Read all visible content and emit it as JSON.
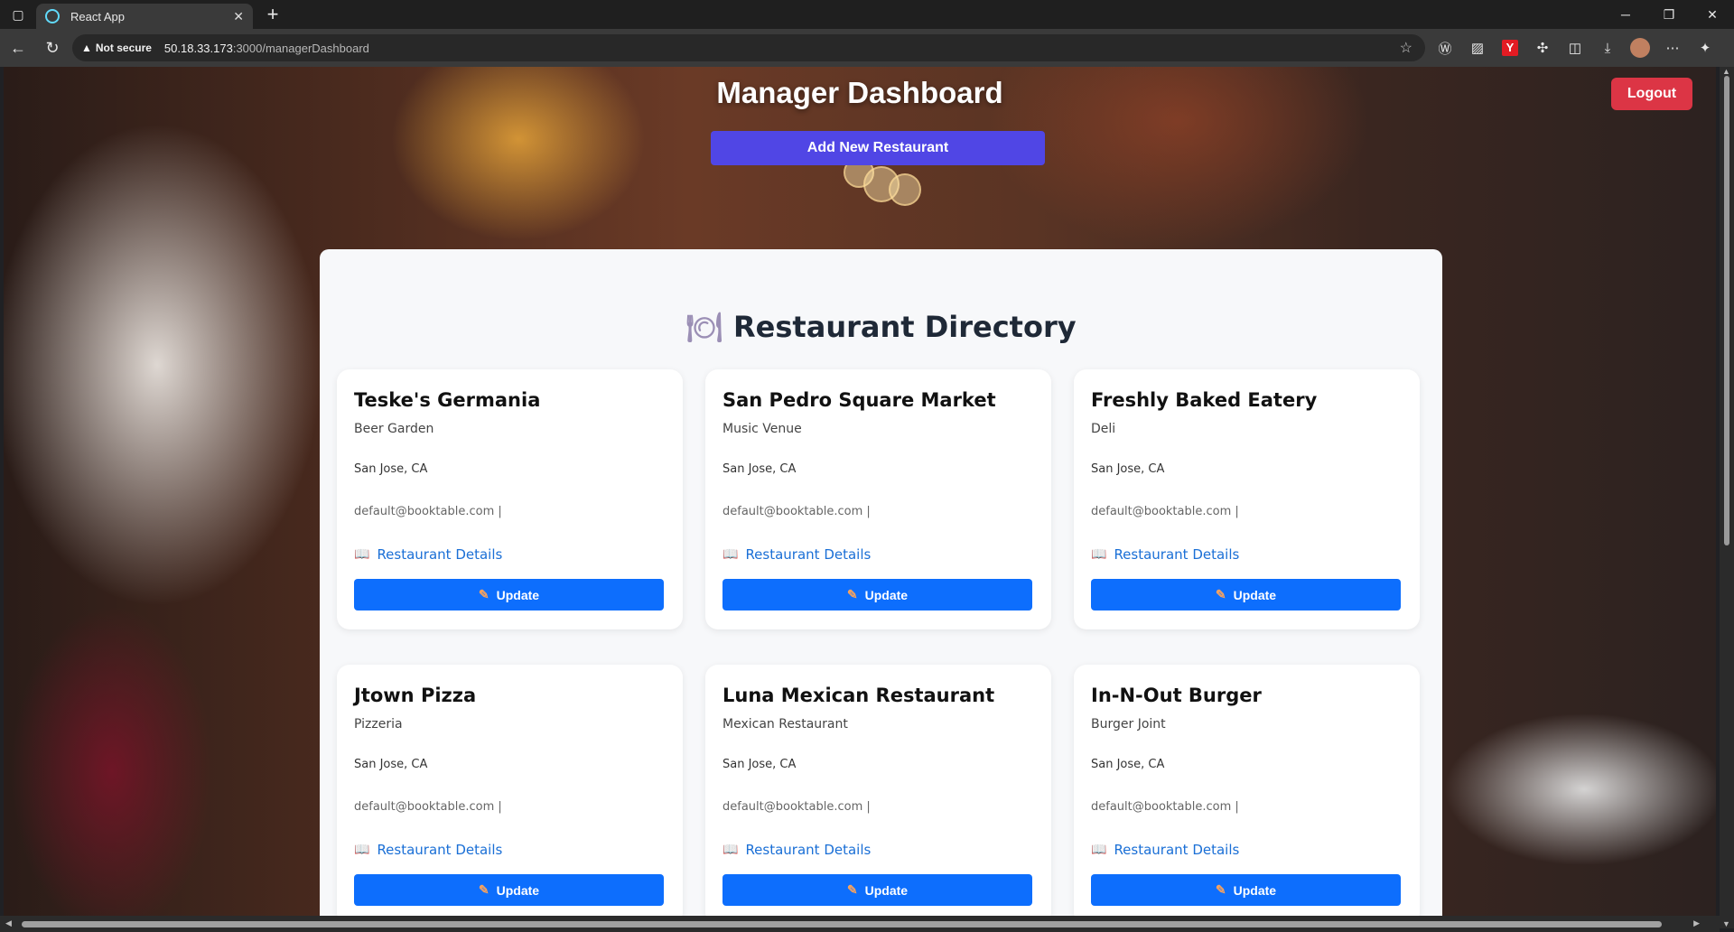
{
  "browser": {
    "tab_title": "React App",
    "security_label": "Not secure",
    "url_host": "50.18.33.173",
    "url_path": ":3000/managerDashboard"
  },
  "header": {
    "title": "Manager Dashboard",
    "logout_label": "Logout",
    "add_label": "Add New Restaurant"
  },
  "directory": {
    "title": "Restaurant Directory",
    "details_label": "Restaurant Details",
    "update_label": "Update",
    "restaurants": [
      {
        "name": "Teske's Germania",
        "cuisine": "Beer Garden",
        "location": "San Jose, CA",
        "email": "default@booktable.com |"
      },
      {
        "name": "San Pedro Square Market",
        "cuisine": "Music Venue",
        "location": "San Jose, CA",
        "email": "default@booktable.com |"
      },
      {
        "name": "Freshly Baked Eatery",
        "cuisine": "Deli",
        "location": "San Jose, CA",
        "email": "default@booktable.com |"
      },
      {
        "name": "Jtown Pizza",
        "cuisine": "Pizzeria",
        "location": "San Jose, CA",
        "email": "default@booktable.com |"
      },
      {
        "name": "Luna Mexican Restaurant",
        "cuisine": "Mexican Restaurant",
        "location": "San Jose, CA",
        "email": "default@booktable.com |"
      },
      {
        "name": "In-N-Out Burger",
        "cuisine": "Burger Joint",
        "location": "San Jose, CA",
        "email": "default@booktable.com |"
      }
    ]
  },
  "colors": {
    "add_button": "#5046e5",
    "logout_button": "#dc3545",
    "update_button": "#0d6efd",
    "link": "#1a6fd6"
  },
  "icons": [
    "react-favicon",
    "plate-cutlery-icon",
    "open-book-icon",
    "pencil-icon"
  ]
}
